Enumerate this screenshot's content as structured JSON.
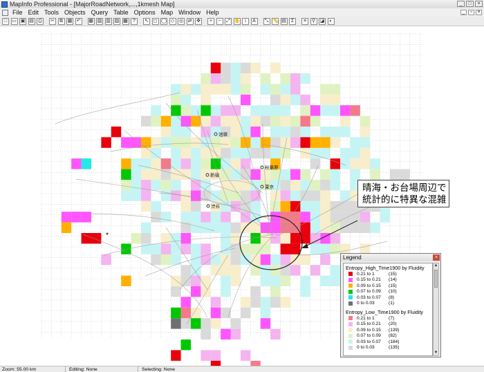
{
  "window": {
    "title": "MapInfo Professional - [MajorRoadNetwork,...,1kmesh Map]",
    "controls": [
      "minimize-icon",
      "maximize-icon",
      "close-icon"
    ]
  },
  "menu": {
    "items": [
      "File",
      "Edit",
      "Tools",
      "Objects",
      "Query",
      "Table",
      "Options",
      "Map",
      "Window",
      "Help"
    ]
  },
  "map": {
    "places": [
      {
        "name": "池袋"
      },
      {
        "name": "秋葉原"
      },
      {
        "name": "新宿"
      },
      {
        "name": "東京"
      },
      {
        "name": "渋谷"
      }
    ],
    "colors": {
      "high_1": "#e8000c",
      "high_2": "#ff55ff",
      "high_3": "#ffb000",
      "high_4": "#00c800",
      "high_5": "#22e8e8",
      "high_6": "#707070",
      "low_1": "#f47a8a",
      "low_2": "#f4b4f0",
      "low_3": "#f8eecc",
      "low_4": "#e0f2c2",
      "low_5": "#c6f4f4",
      "low_6": "#dadada"
    }
  },
  "callout": {
    "line1": "晴海・お台場周辺で",
    "line2": "統計的に特異な混雑"
  },
  "legend": {
    "title": "Legend",
    "sections": [
      {
        "name": "Entropy_High_Time1900 by Fluidity",
        "rows": [
          {
            "range": "0.21 to 1",
            "count": "(15)",
            "color": "#e8000c"
          },
          {
            "range": "0.15 to 0.21",
            "count": "(14)",
            "color": "#ff55ff"
          },
          {
            "range": "0.09 to 0.15",
            "count": "(15)",
            "color": "#ffb000"
          },
          {
            "range": "0.07 to 0.09",
            "count": "(10)",
            "color": "#00c800"
          },
          {
            "range": "0.03 to 0.07",
            "count": "(8)",
            "color": "#22e8e8"
          },
          {
            "range": "0    to 0.03",
            "count": "(1)",
            "color": "#707070"
          }
        ]
      },
      {
        "name": "Entropy_Low_Time1900 by Fluidity",
        "rows": [
          {
            "range": "0.21 to 1",
            "count": "(7)",
            "color": "#f47a8a"
          },
          {
            "range": "0.15 to 0.21",
            "count": "(20)",
            "color": "#f4b4f0"
          },
          {
            "range": "0.09 to 0.15",
            "count": "(139)",
            "color": "#f8eecc"
          },
          {
            "range": "0.07 to 0.09",
            "count": "(82)",
            "color": "#e0f2c2"
          },
          {
            "range": "0.03 to 0.07",
            "count": "(184)",
            "color": "#c6f4f4"
          },
          {
            "range": "0    to 0.03",
            "count": "(135)",
            "color": "#dadada"
          }
        ]
      }
    ]
  },
  "status": {
    "zoom": "Zoom: 55.00 km",
    "editing": "Editing: None",
    "selecting": "Selecting: None"
  }
}
